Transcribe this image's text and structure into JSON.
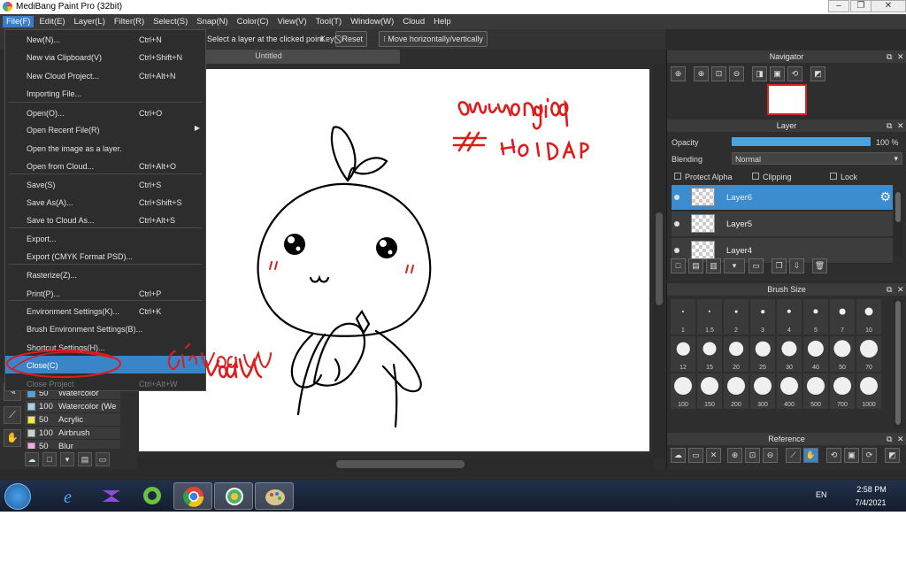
{
  "window": {
    "title": "MediBang Paint Pro (32bit)"
  },
  "menubar": [
    "File(F)",
    "Edit(E)",
    "Layer(L)",
    "Filter(R)",
    "Select(S)",
    "Snap(N)",
    "Color(C)",
    "View(V)",
    "Tool(T)",
    "Window(W)",
    "Cloud",
    "Help"
  ],
  "toolbar": {
    "hint": "Select a layer at the clicked point",
    "key_label": "Key",
    "reset_label": "Reset",
    "move_label": "Move horizontally/vertically"
  },
  "document": {
    "tab_title": "Untitled"
  },
  "file_menu": [
    {
      "label": "New(N)...",
      "shortcut": "Ctrl+N"
    },
    {
      "label": "New via Clipboard(V)",
      "shortcut": "Ctrl+Shift+N"
    },
    {
      "label": "New Cloud Project...",
      "shortcut": "Ctrl+Alt+N"
    },
    {
      "label": "Importing File...",
      "shortcut": ""
    },
    {
      "label": "Open(O)...",
      "shortcut": "Ctrl+O"
    },
    {
      "label": "Open Recent File(R)",
      "shortcut": ""
    },
    {
      "label": "Open the image as a layer.",
      "shortcut": ""
    },
    {
      "label": "Open from Cloud...",
      "shortcut": "Ctrl+Alt+O"
    },
    {
      "label": "Save(S)",
      "shortcut": "Ctrl+S"
    },
    {
      "label": "Save As(A)...",
      "shortcut": "Ctrl+Shift+S"
    },
    {
      "label": "Save to Cloud As...",
      "shortcut": "Ctrl+Alt+S"
    },
    {
      "label": "Export...",
      "shortcut": ""
    },
    {
      "label": "Export (CMYK Format PSD)...",
      "shortcut": ""
    },
    {
      "label": "Rasterize(Z)...",
      "shortcut": ""
    },
    {
      "label": "Print(P)...",
      "shortcut": "Ctrl+P"
    },
    {
      "label": "Environment Settings(K)...",
      "shortcut": "Ctrl+K"
    },
    {
      "label": "Brush Environment Settings(B)...",
      "shortcut": ""
    },
    {
      "label": "Shortcut Settings(H)...",
      "shortcut": ""
    },
    {
      "label": "Close(C)",
      "shortcut": ""
    },
    {
      "label": "Close Project",
      "shortcut": "Ctrl+Alt+W"
    }
  ],
  "brushes": [
    {
      "size": "50",
      "name": "Watercolor",
      "color": "#4da3e0"
    },
    {
      "size": "100",
      "name": "Watercolor (We",
      "color": "#9fd0f0"
    },
    {
      "size": "50",
      "name": "Acrylic",
      "color": "#f2ea3a"
    },
    {
      "size": "100",
      "name": "Airbrush",
      "color": "#cfcfcf"
    },
    {
      "size": "50",
      "name": "Blur",
      "color": "#f7a6e8"
    }
  ],
  "navigator": {
    "title": "Navigator"
  },
  "layer_panel": {
    "title": "Layer",
    "opacity_label": "Opacity",
    "opacity_value": "100 %",
    "opacity_fraction": 1.0,
    "blending_label": "Blending",
    "blending_value": "Normal",
    "protect_alpha": "Protect Alpha",
    "clipping": "Clipping",
    "lock": "Lock",
    "layers": [
      "Layer6",
      "Layer5",
      "Layer4"
    ],
    "selected_layer": "Layer6"
  },
  "brush_size_panel": {
    "title": "Brush Size",
    "sizes": [
      "1",
      "1.5",
      "2",
      "3",
      "4",
      "5",
      "7",
      "10",
      "12",
      "15",
      "20",
      "25",
      "30",
      "40",
      "50",
      "70",
      "100",
      "150",
      "200",
      "300",
      "400",
      "500",
      "700",
      "1000"
    ]
  },
  "reference_panel": {
    "title": "Reference"
  },
  "canvas_annotations": {
    "handwriting_top": "anhvuong198",
    "handwriting_tag": "# HOIDAP",
    "handwriting_click": "Click vao"
  },
  "taskbar": {
    "lang": "EN",
    "time": "2:58 PM",
    "date": "7/4/2021"
  },
  "colors": {
    "accent": "#3a85c9",
    "annotation_red": "#e01b1b"
  }
}
